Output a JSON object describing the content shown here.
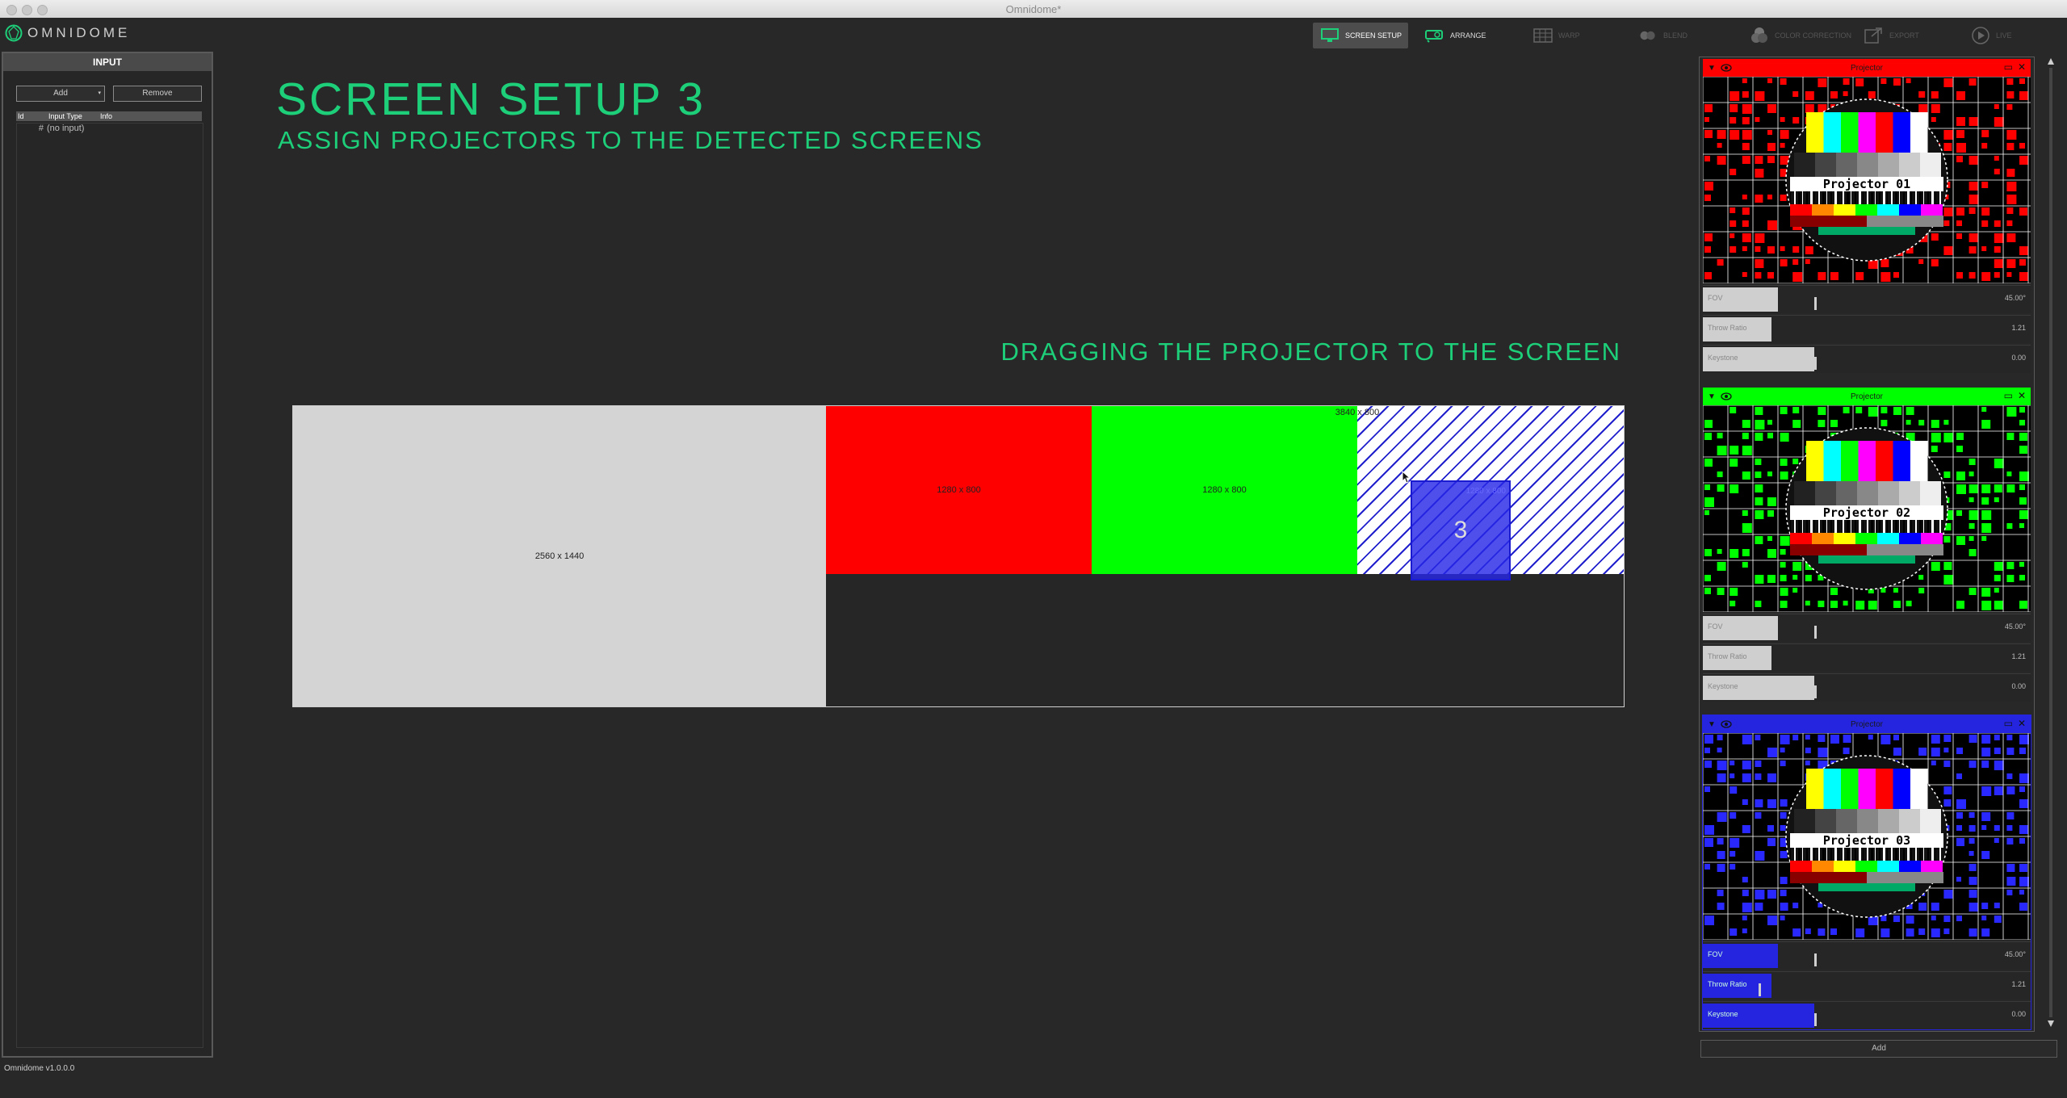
{
  "window": {
    "title": "Omnidome*"
  },
  "app": {
    "logo_text": "OMNIDOME"
  },
  "toolbar": {
    "modes": [
      {
        "label": "SCREEN SETUP",
        "icon": "monitor-icon",
        "active": true
      },
      {
        "label": "ARRANGE",
        "icon": "projector-icon",
        "active": false
      },
      {
        "label": "WARP",
        "icon": "grid-icon",
        "active": false
      },
      {
        "label": "BLEND",
        "icon": "blend-icon",
        "active": false
      },
      {
        "label": "COLOR CORRECTION",
        "icon": "color-correction-icon",
        "active": false
      },
      {
        "label": "EXPORT",
        "icon": "export-icon",
        "active": false
      },
      {
        "label": "LIVE",
        "icon": "play-icon",
        "active": false
      }
    ]
  },
  "input_panel": {
    "title": "INPUT",
    "add_label": "Add",
    "remove_label": "Remove",
    "columns": [
      "Id",
      "Input Type",
      "Info"
    ],
    "rows": [
      {
        "id": "#",
        "type": "(no input)",
        "info": ""
      }
    ]
  },
  "main": {
    "title": "SCREEN SETUP 3",
    "subtitle": "ASSIGN PROJECTORS TO THE DETECTED SCREENS",
    "hint": "DRAGGING THE PROJECTOR TO THE SCREEN",
    "screens": {
      "big": "2560 x 1440",
      "red": "1280 x 800",
      "green": "1280 x 800",
      "tiled": "3840 x 800",
      "drag_ghost": "1280 x 800",
      "drag_number": "3"
    }
  },
  "projectors": [
    {
      "title": "Projector",
      "label": "Projector 01",
      "color": "#ff0000",
      "pattern": "#ff0000",
      "fov_name": "FOV",
      "fov": "45.00°",
      "fov_frac": 0.23,
      "throw_name": "Throw Ratio",
      "throw": "1.21",
      "throw_frac": 0.21,
      "key_name": "Keystone",
      "key": "0.00",
      "key_frac": 0.34,
      "selected": false
    },
    {
      "title": "Projector",
      "label": "Projector 02",
      "color": "#00ff00",
      "pattern": "#00ff00",
      "fov_name": "FOV",
      "fov": "45.00°",
      "fov_frac": 0.23,
      "throw_name": "Throw Ratio",
      "throw": "1.21",
      "throw_frac": 0.21,
      "key_name": "Keystone",
      "key": "0.00",
      "key_frac": 0.34,
      "selected": false
    },
    {
      "title": "Projector",
      "label": "Projector 03",
      "color": "#2525e0",
      "pattern": "#2828ff",
      "fov_name": "FOV",
      "fov": "45.00°",
      "fov_frac": 0.23,
      "throw_name": "Throw Ratio",
      "throw": "1.21",
      "throw_frac": 0.21,
      "key_name": "Keystone",
      "key": "0.00",
      "key_frac": 0.34,
      "selected": true
    }
  ],
  "right_panel": {
    "add_label": "Add"
  },
  "footer": {
    "version": "Omnidome v1.0.0.0"
  }
}
